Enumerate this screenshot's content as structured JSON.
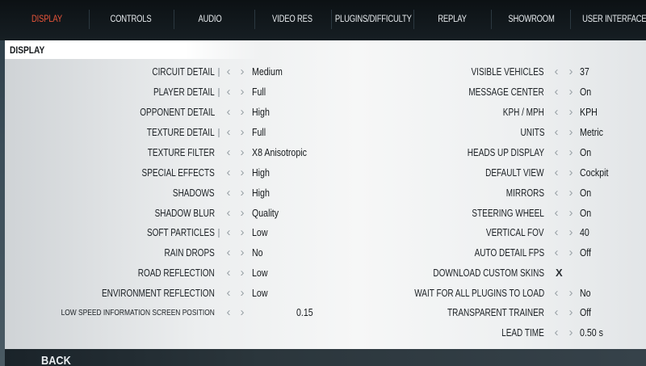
{
  "tabs": [
    {
      "label": "DISPLAY",
      "active": true
    },
    {
      "label": "CONTROLS",
      "active": false
    },
    {
      "label": "AUDIO",
      "active": false
    },
    {
      "label": "VIDEO RES",
      "active": false
    },
    {
      "label": "PLUGINS/DIFFICULTY",
      "active": false
    },
    {
      "label": "REPLAY",
      "active": false
    },
    {
      "label": "SHOWROOM",
      "active": false
    },
    {
      "label": "USER INTERFACE",
      "active": false
    }
  ],
  "section_title": "DISPLAY",
  "left_settings": [
    {
      "label": "CIRCUIT DETAIL",
      "value": "Medium"
    },
    {
      "label": "PLAYER DETAIL",
      "value": "Full"
    },
    {
      "label": "OPPONENT DETAIL",
      "value": "High"
    },
    {
      "label": "TEXTURE DETAIL",
      "value": "Full"
    },
    {
      "label": "TEXTURE FILTER",
      "value": "X8 Anisotropic"
    },
    {
      "label": "SPECIAL EFFECTS",
      "value": "High"
    },
    {
      "label": "SHADOWS",
      "value": "High"
    },
    {
      "label": "SHADOW BLUR",
      "value": "Quality"
    },
    {
      "label": "SOFT PARTICLES",
      "value": "Low"
    },
    {
      "label": "RAIN DROPS",
      "value": "No"
    },
    {
      "label": "ROAD REFLECTION",
      "value": "Low"
    },
    {
      "label": "ENVIRONMENT REFLECTION",
      "value": "Low"
    },
    {
      "label": "LOW SPEED INFORMATION SCREEN POSITION",
      "value": "0.15"
    }
  ],
  "right_settings": [
    {
      "label": "VISIBLE VEHICLES",
      "value": "37"
    },
    {
      "label": "MESSAGE CENTER",
      "value": "On"
    },
    {
      "label": "KPH / MPH",
      "value": "KPH"
    },
    {
      "label": "UNITS",
      "value": "Metric"
    },
    {
      "label": "HEADS UP DISPLAY",
      "value": "On"
    },
    {
      "label": "DEFAULT VIEW",
      "value": "Cockpit"
    },
    {
      "label": "MIRRORS",
      "value": "On"
    },
    {
      "label": "STEERING WHEEL",
      "value": "On"
    },
    {
      "label": "VERTICAL FOV",
      "value": "40"
    },
    {
      "label": "AUTO DETAIL FPS",
      "value": "Off"
    },
    {
      "label": "DOWNLOAD CUSTOM SKINS",
      "value": "X"
    },
    {
      "label": "WAIT FOR ALL PLUGINS TO LOAD",
      "value": "No"
    },
    {
      "label": "TRANSPARENT TRAINER",
      "value": "Off"
    },
    {
      "label": "LEAD TIME",
      "value": "0.50 s"
    }
  ],
  "back_label": "BACK",
  "colors": {
    "active_tab": "#e8553a",
    "topbar": "#0c1114",
    "panel": "#eef0f1"
  },
  "icons": {
    "prev": "chevron-left-icon",
    "next": "chevron-right-icon",
    "checkbox": "x-checkbox-icon"
  }
}
